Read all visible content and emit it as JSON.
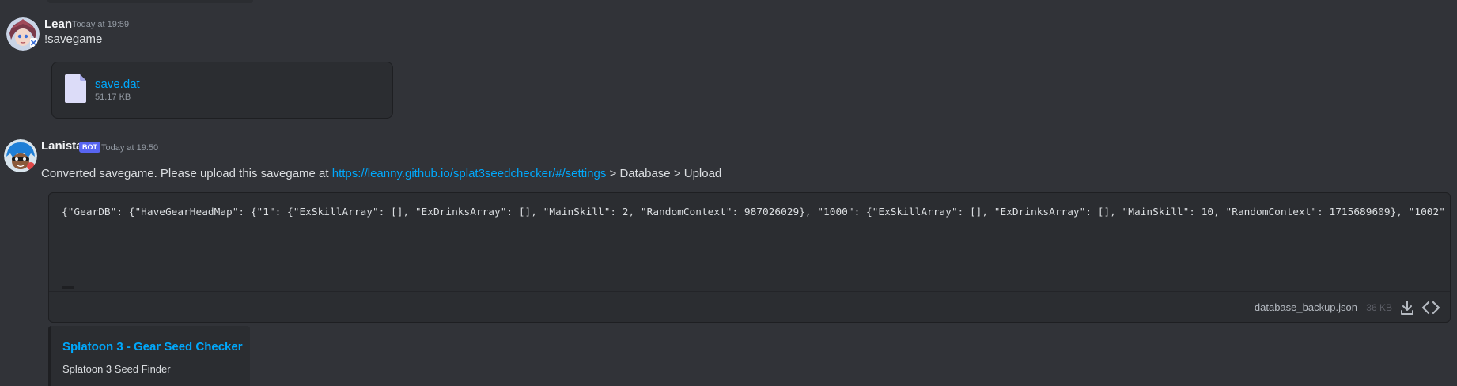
{
  "messages": [
    {
      "username": "Lean",
      "timestamp": "Today at 19:59",
      "content": "!savegame",
      "avatar_icon": "anime-character-avatar",
      "attachment": {
        "file_name": "save.dat",
        "file_size": "51.17 KB",
        "icon": "file-icon"
      }
    },
    {
      "username": "Lanista",
      "badge": "BOT",
      "timestamp": "Today at 19:50",
      "avatar_icon": "squid-character-avatar",
      "text_before_link": "Converted savegame. Please upload this savegame at ",
      "link": "https://leanny.github.io/splat3seedchecker/#/settings",
      "text_after_link": " > Database > Upload",
      "code_preview": "{\"GearDB\": {\"HaveGearHeadMap\": {\"1\": {\"ExSkillArray\": [], \"ExDrinksArray\": [], \"MainSkill\": 2, \"RandomContext\": 987026029}, \"1000\": {\"ExSkillArray\": [], \"ExDrinksArray\": [], \"MainSkill\": 10, \"RandomContext\": 1715689609}, \"1002\"",
      "code_file": {
        "file_name": "database_backup.json",
        "file_size": "36 KB",
        "download_icon": "download-icon",
        "view_code_icon": "code-icon"
      },
      "embed": {
        "title": "Splatoon 3 - Gear Seed Checker",
        "description": "Splatoon 3 Seed Finder"
      }
    }
  ],
  "colors": {
    "background": "#313338",
    "card": "#2b2d31",
    "link": "#00a8fc",
    "bot_badge": "#5865f2",
    "muted": "#949ba4"
  }
}
